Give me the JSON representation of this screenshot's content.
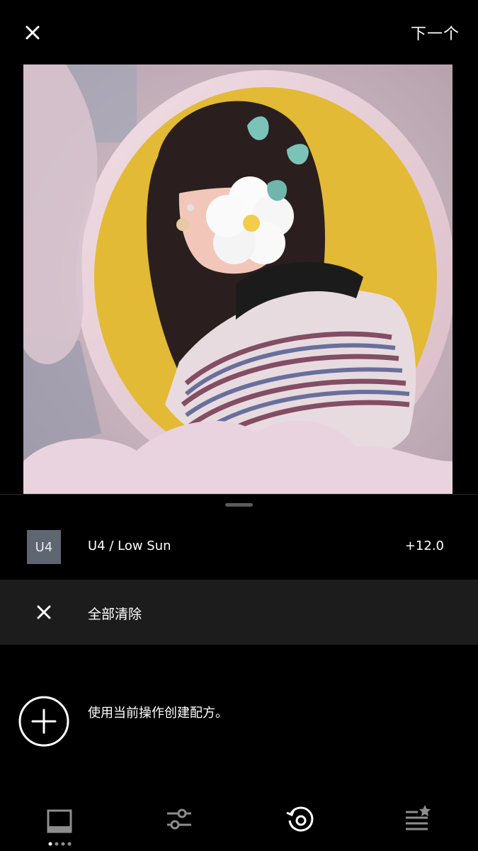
{
  "topbar": {
    "next_label": "下一个"
  },
  "preset": {
    "badge": "U4",
    "name": "U4 / Low Sun",
    "value": "+12.0"
  },
  "actions": {
    "clear_label": "全部清除",
    "create_recipe_label": "使用当前操作创建配方。"
  },
  "icons": {
    "close": "close-icon",
    "clear": "close-icon",
    "add": "plus-circle-icon",
    "tab_presets": "presets-icon",
    "tab_adjust": "sliders-icon",
    "tab_history": "history-icon",
    "tab_recipes": "recipes-icon"
  },
  "colors": {
    "badge": "#5e6672",
    "clear_row": "#1c1c1c"
  }
}
